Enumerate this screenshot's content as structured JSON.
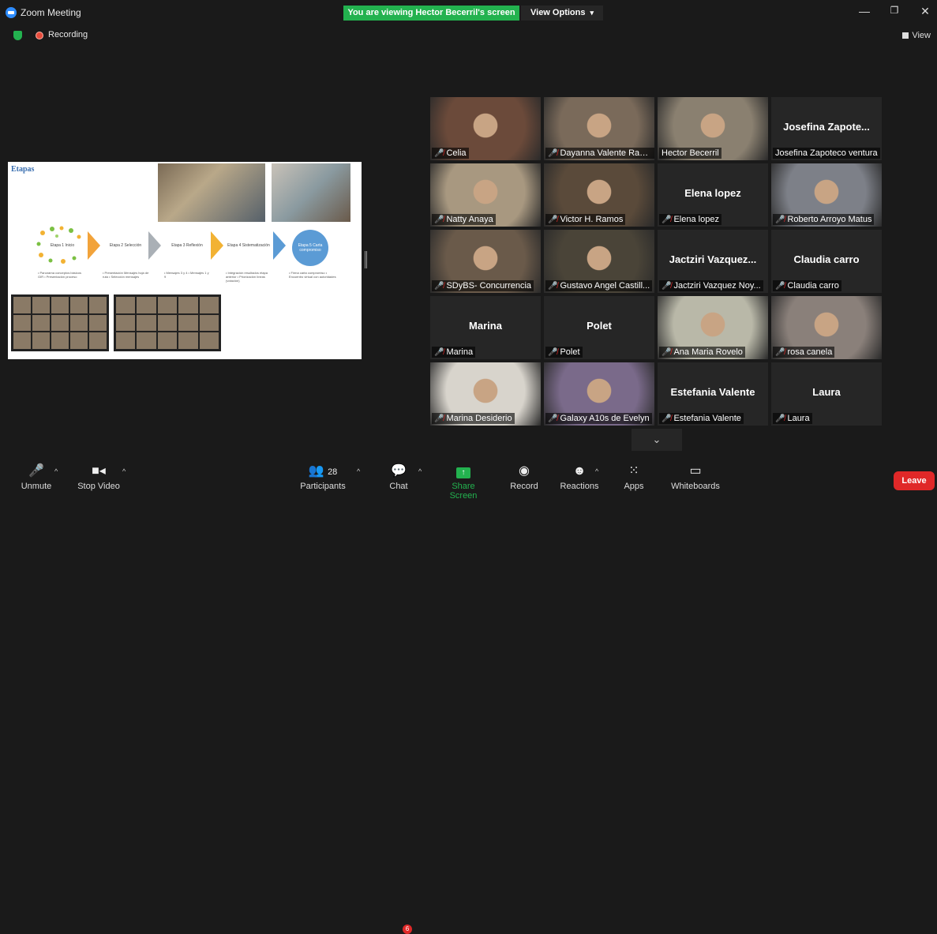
{
  "app": {
    "title": "Zoom Meeting"
  },
  "banner": {
    "viewing": "You are viewing Hector Becerril's screen",
    "view_options": "View Options"
  },
  "status": {
    "recording": "Recording",
    "view": "View"
  },
  "slide": {
    "title": "Etapas",
    "stages": [
      "Etapa 1 Inicio",
      "Etapa 2 Selección",
      "Etapa 3 Reflexión",
      "Etapa 4 Sistematización",
      "Etapa 5 Carta compromiso"
    ],
    "bullets": [
      "• Panorama conceptos básicos GIR • Presentación proceso",
      "• Presentación Mensajes hoja de ruta • Selección mensajes",
      "• Mensajes 3 y 4 • Mensajes 1 y 9",
      "• Integración resultados etapa anterior • Priorización líneas (votación)",
      "• Firma carta compromiso • Encuentro virtual con autoridades"
    ]
  },
  "participants": [
    {
      "name": "Celia",
      "video": true,
      "muted": true,
      "color": "#6b4a3a"
    },
    {
      "name": "Dayanna Valente Ram...",
      "video": true,
      "muted": true,
      "color": "#7a6a5a"
    },
    {
      "name": "Hector Becerril",
      "video": true,
      "muted": false,
      "active": true,
      "color": "#8a8070"
    },
    {
      "name": "Josefina Zapoteco ventura",
      "display": "Josefina  Zapote...",
      "video": false,
      "muted": false
    },
    {
      "name": "Natty Anaya",
      "video": true,
      "muted": true,
      "color": "#a89880"
    },
    {
      "name": "Victor H. Ramos",
      "video": true,
      "muted": true,
      "color": "#5a4a3a"
    },
    {
      "name": "Elena lopez",
      "display": "Elena lopez",
      "video": false,
      "muted": true
    },
    {
      "name": "Roberto Arroyo Matus",
      "video": true,
      "muted": true,
      "color": "#7d8088"
    },
    {
      "name": "SDyBS- Concurrencia",
      "video": true,
      "muted": true,
      "color": "#6a5a4a"
    },
    {
      "name": "Gustavo Angel Castill...",
      "video": true,
      "muted": true,
      "color": "#4a4438"
    },
    {
      "name": "Jactziri Vazquez Noy...",
      "display": "Jactziri  Vazquez...",
      "video": false,
      "muted": true
    },
    {
      "name": "Claudia carro",
      "display": "Claudia carro",
      "video": false,
      "muted": true
    },
    {
      "name": "Marina",
      "display": "Marina",
      "video": false,
      "muted": true
    },
    {
      "name": "Polet",
      "display": "Polet",
      "video": false,
      "muted": true
    },
    {
      "name": "Ana Maria Rovelo",
      "video": true,
      "muted": true,
      "color": "#b9b8a8"
    },
    {
      "name": "rosa canela",
      "video": true,
      "muted": true,
      "color": "#8a807a"
    },
    {
      "name": "Marina Desiderio",
      "video": true,
      "muted": true,
      "color": "#d8d4cc"
    },
    {
      "name": "Galaxy A10s de Evelyn",
      "video": true,
      "muted": true,
      "color": "#7a6a8a"
    },
    {
      "name": "Estefania Valente",
      "display": "Estefania Valente",
      "video": false,
      "muted": true
    },
    {
      "name": "Laura",
      "display": "Laura",
      "video": false,
      "muted": true
    }
  ],
  "toolbar": {
    "unmute": "Unmute",
    "stop_video": "Stop Video",
    "participants": "Participants",
    "participants_count": "28",
    "chat": "Chat",
    "chat_badge": "6",
    "share": "Share Screen",
    "record": "Record",
    "reactions": "Reactions",
    "apps": "Apps",
    "whiteboards": "Whiteboards",
    "leave": "Leave"
  },
  "colors": {
    "accent_green": "#23b24f",
    "leave_red": "#e02828",
    "active_speaker": "#c6e049"
  }
}
